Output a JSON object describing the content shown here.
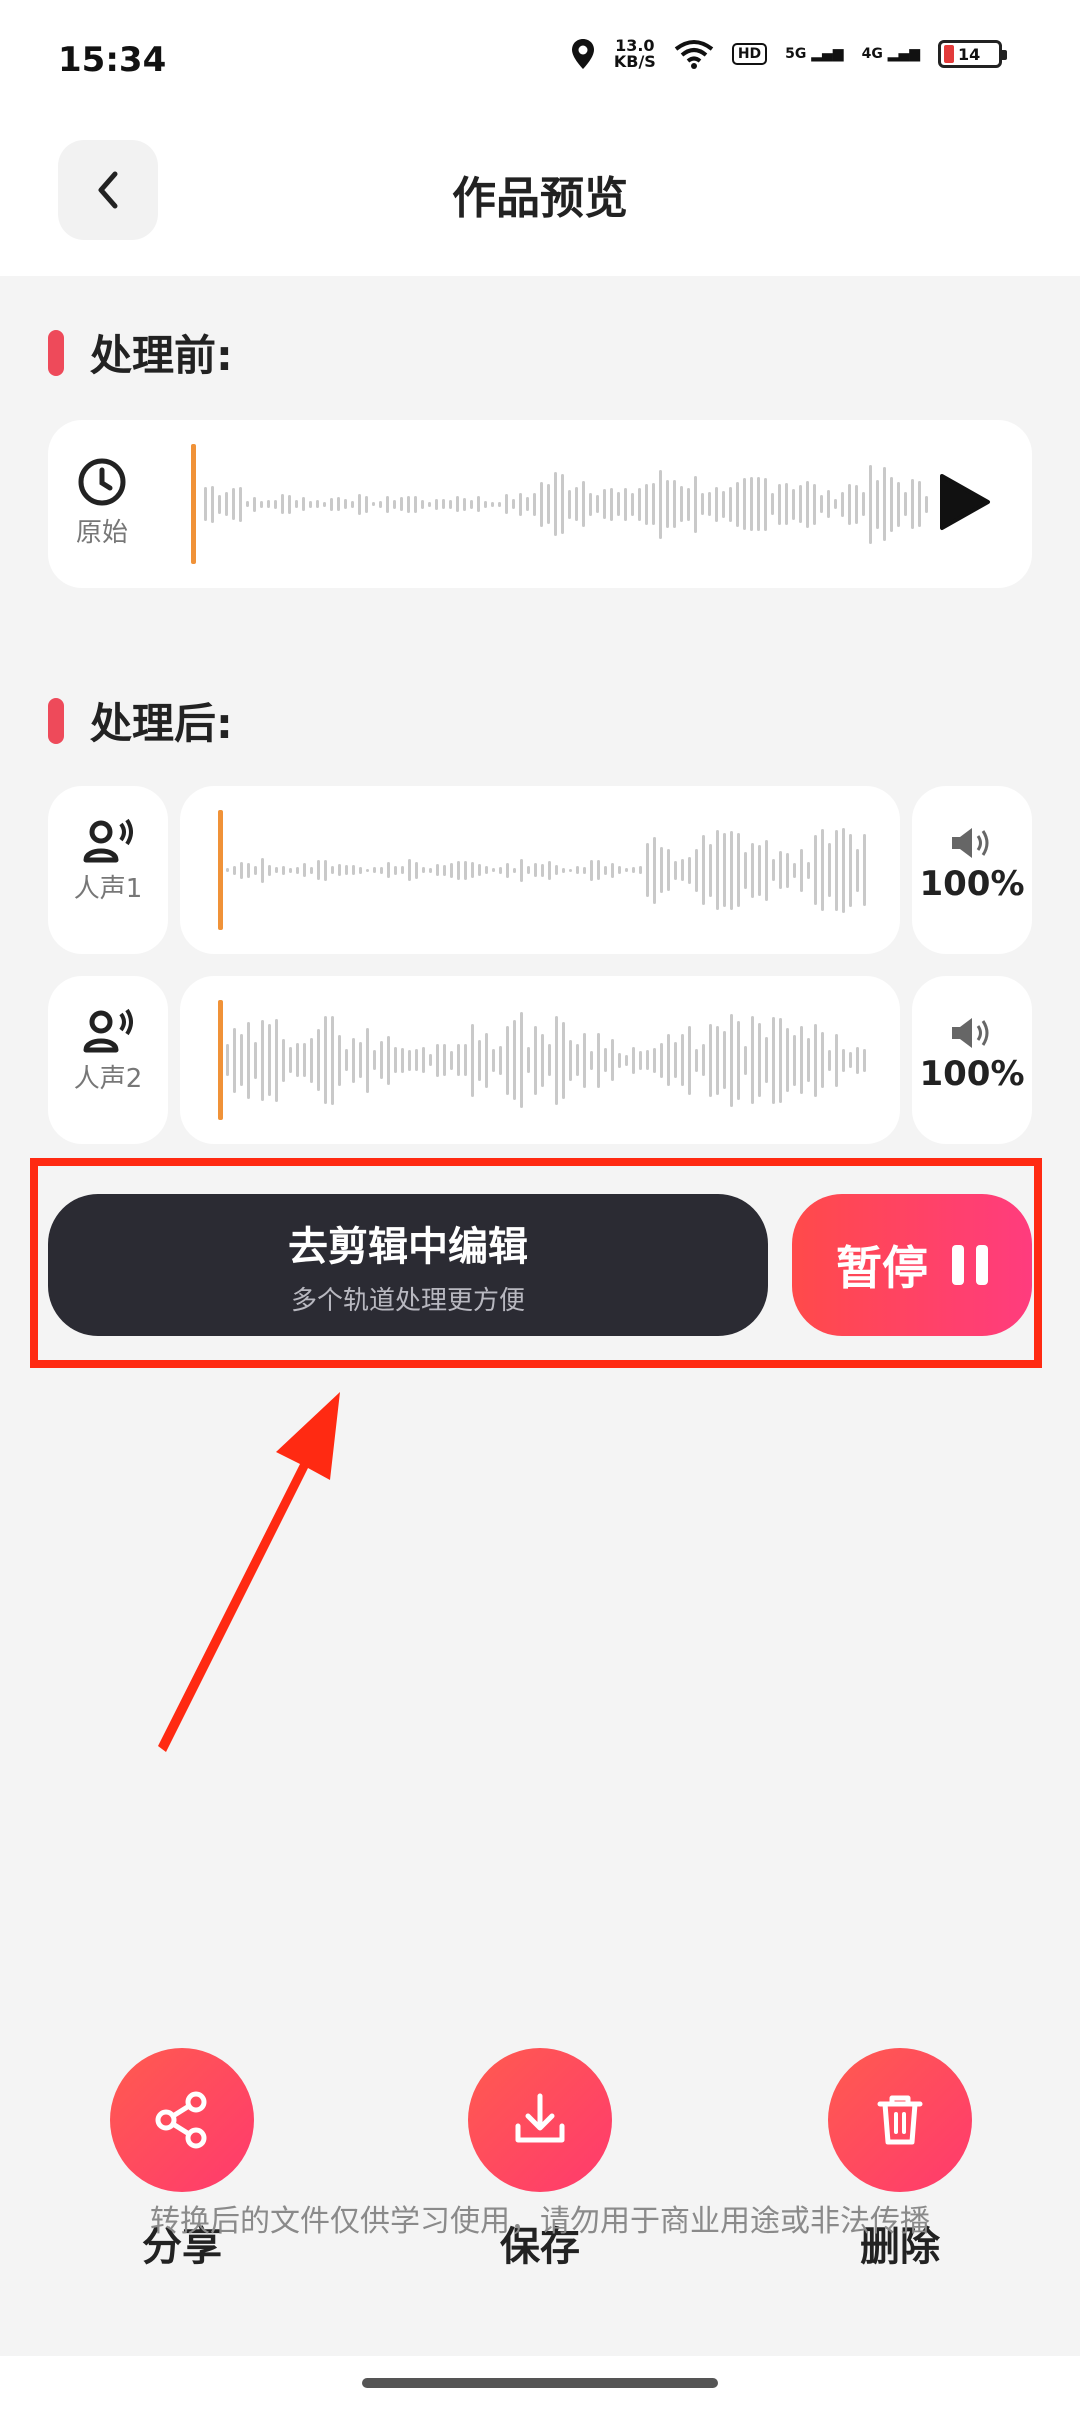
{
  "status_bar": {
    "time": "15:34",
    "speed_value": "13.0",
    "speed_unit": "KB/S",
    "hd_badge": "HD",
    "net1": "5G",
    "net2": "4G",
    "battery": "14"
  },
  "header": {
    "title": "作品预览"
  },
  "before": {
    "title": "处理前:",
    "track_label": "原始"
  },
  "after": {
    "title": "处理后:",
    "tracks": [
      {
        "label": "人声1",
        "volume": "100%"
      },
      {
        "label": "人声2",
        "volume": "100%"
      }
    ]
  },
  "actions": {
    "edit_title": "去剪辑中编辑",
    "edit_subtitle": "多个轨道处理更方便",
    "pause_label": "暂停"
  },
  "bottom": {
    "share": "分享",
    "save": "保存",
    "delete": "删除"
  },
  "disclaimer": "转换后的文件仅供学习使用，请勿用于商业用途或非法传播",
  "colors": {
    "accent": "#ff3a6e",
    "accent_start": "#ff4a4a",
    "dark_button": "#2b2b33",
    "playhead": "#f09238",
    "highlight_box": "#ff2a12"
  }
}
